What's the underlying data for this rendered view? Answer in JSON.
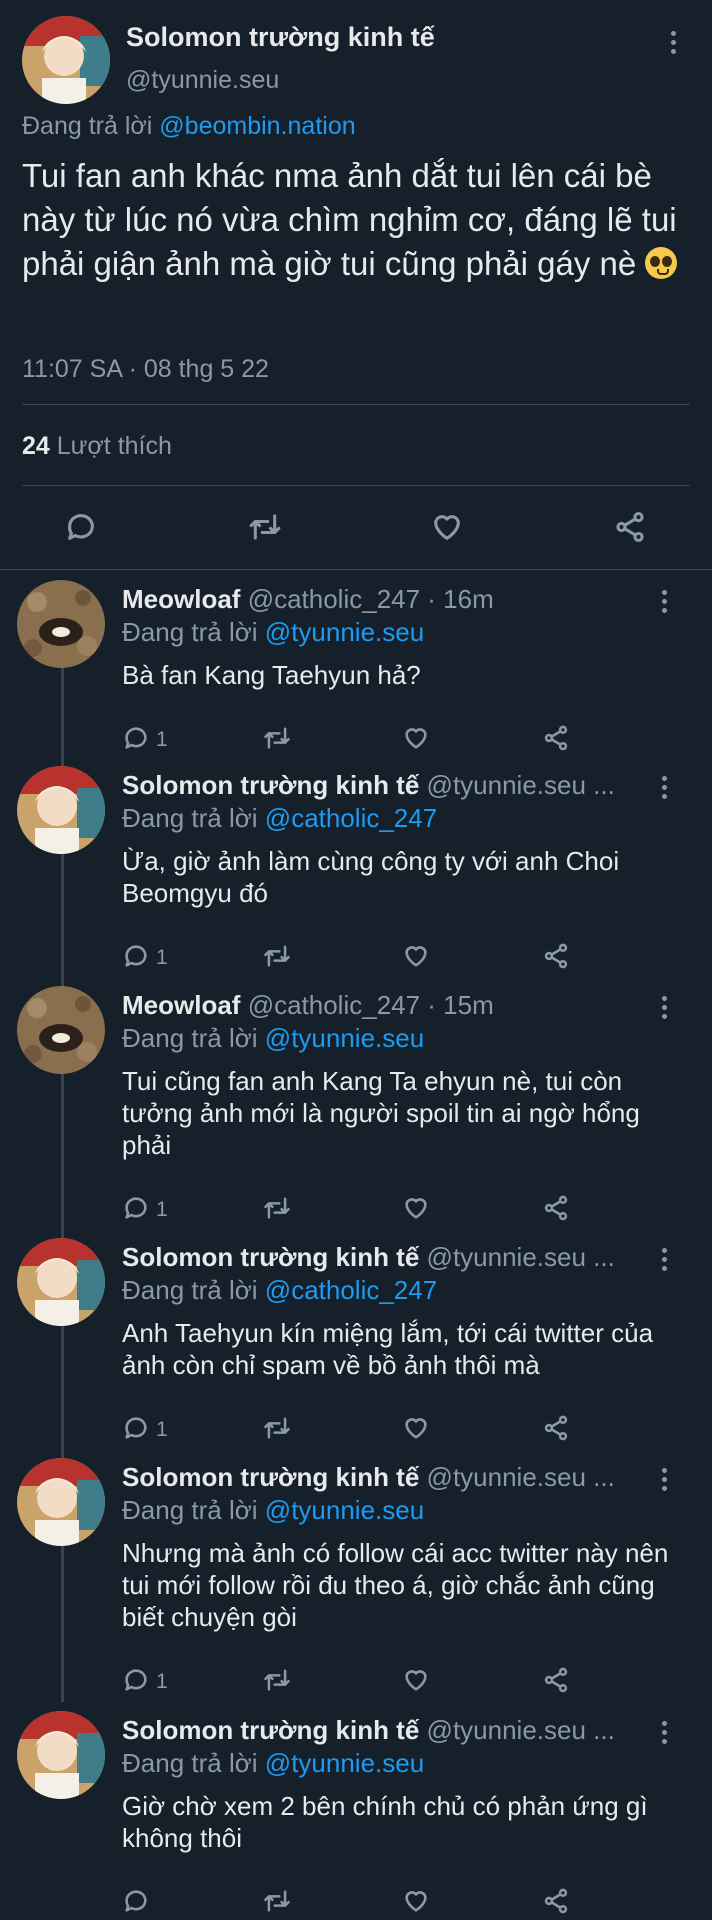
{
  "main_tweet": {
    "display_name": "Solomon trường kinh tế",
    "handle": "@tyunnie.seu",
    "replying_prefix": "Đang trả lời",
    "replying_to": "@beombin.nation",
    "text": "Tui fan anh khác nma ảnh dắt tui lên cái bè này từ lúc nó vừa chìm nghỉm cơ, đáng lẽ tui phải giận ảnh mà giờ tui cũng phải gáy nè",
    "emoji": "pleading-face-emoji",
    "timestamp": "11:07 SA · 08 thg 5 22",
    "likes_count": "24",
    "likes_label": "Lượt thích",
    "actions": [
      "comment-icon",
      "retweet-icon",
      "heart-icon",
      "share-icon"
    ]
  },
  "replies": [
    {
      "display_name": "Meowloaf",
      "handle": "@catholic_247 · 16m",
      "replying_prefix": "Đang trả lời",
      "replying_to": "@tyunnie.seu",
      "text": "Bà fan Kang Taehyun hả?",
      "reply_count": "1",
      "avatar": "rocks-avatar"
    },
    {
      "display_name": "Solomon trường kinh tế",
      "handle": "@tyunnie.seu ...",
      "replying_prefix": "Đang trả lời",
      "replying_to": "@catholic_247",
      "text": "Ừa, giờ ảnh làm cùng công ty với anh Choi Beomgyu đó",
      "reply_count": "1",
      "avatar": "person-avatar"
    },
    {
      "display_name": "Meowloaf",
      "handle": "@catholic_247 · 15m",
      "replying_prefix": "Đang trả lời",
      "replying_to": "@tyunnie.seu",
      "text": "Tui cũng fan anh Kang Ta ehyun nè, tui còn tưởng ảnh mới là người spoil tin ai ngờ hổng phải",
      "reply_count": "1",
      "avatar": "rocks-avatar"
    },
    {
      "display_name": "Solomon trường kinh tế",
      "handle": "@tyunnie.seu ...",
      "replying_prefix": "Đang trả lời",
      "replying_to": "@catholic_247",
      "text": "Anh Taehyun kín miệng lắm, tới cái twitter của ảnh còn chỉ spam về bồ ảnh thôi mà",
      "reply_count": "1",
      "avatar": "person-avatar"
    },
    {
      "display_name": "Solomon trường kinh tế",
      "handle": "@tyunnie.seu ...",
      "replying_prefix": "Đang trả lời",
      "replying_to": "@tyunnie.seu",
      "text": "Nhưng mà ảnh có follow cái acc twitter này nên tui mới follow rồi đu theo á, giờ chắc ảnh cũng biết chuyện gòi",
      "reply_count": "1",
      "avatar": "person-avatar"
    },
    {
      "display_name": "Solomon trường kinh tế",
      "handle": "@tyunnie.seu ...",
      "replying_prefix": "Đang trả lời",
      "replying_to": "@tyunnie.seu",
      "text": "Giờ chờ xem 2 bên chính chủ có phản ứng gì không thôi",
      "reply_count": "",
      "avatar": "person-avatar"
    }
  ],
  "colors": {
    "background": "#15202b",
    "link": "#1d9bf0",
    "muted": "#8b98a5",
    "text": "#e7e9ea",
    "divider": "#38444d"
  }
}
